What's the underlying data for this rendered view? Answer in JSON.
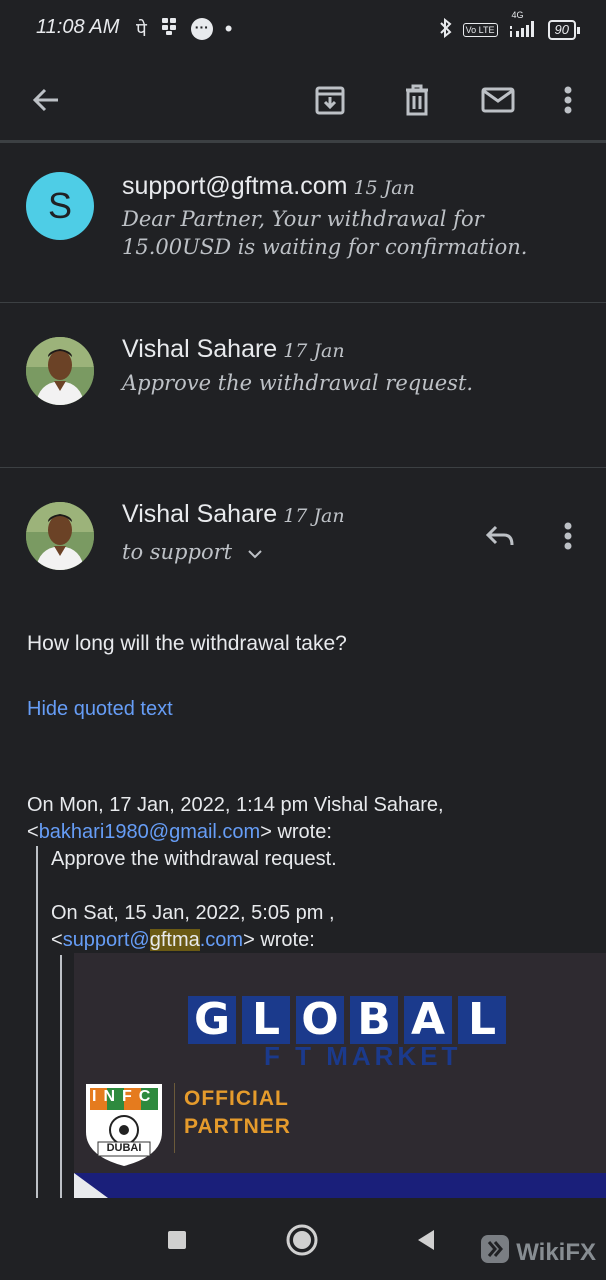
{
  "status_bar": {
    "time": "11:08 AM",
    "left_icons": [
      "pe-icon",
      "bbm-icon",
      "chat-icon"
    ],
    "network": "4G",
    "volte": "Vo LTE",
    "battery": "90"
  },
  "toolbar": {
    "icons": [
      "back-arrow-icon",
      "archive-icon",
      "delete-icon",
      "mark-unread-icon",
      "more-vert-icon"
    ]
  },
  "messages": [
    {
      "avatar_letter": "S",
      "sender": "support@gftma.com",
      "date": "15 Jan",
      "snippet": "Dear Partner, Your withdrawal for 15.00USD is waiting for confirmation."
    },
    {
      "sender": "Vishal Sahare",
      "date": "17 Jan",
      "snippet": "Approve the withdrawal request."
    }
  ],
  "open_message": {
    "sender": "Vishal Sahare",
    "date": "17 Jan",
    "to_line": "to support",
    "body": "How long will the withdrawal take?",
    "hide_quoted": "Hide quoted text",
    "quote_header_line1": "On Mon, 17 Jan, 2022, 1:14 pm Vishal Sahare,",
    "quote_email_open": "<",
    "quote_email": "bakhari1980@gmail.com",
    "quote_email_close": "> wrote:",
    "quote1_text": "Approve the withdrawal request.",
    "quote2_header": "On Sat, 15 Jan, 2022, 5:05 pm ,",
    "quote2_open": "<",
    "quote2_email_a": "support@",
    "quote2_email_highlight": "gftma",
    "quote2_email_b": ".com",
    "quote2_close": "> wrote:"
  },
  "banner": {
    "letters": [
      "G",
      "L",
      "O",
      "B",
      "A",
      "L"
    ],
    "subtitle": "F T MARKET",
    "badge_letters": "INFC",
    "badge_city": "DUBAI",
    "partner_line1": "OFFICIAL",
    "partner_line2": "PARTNER"
  },
  "watermark": "WikiFX",
  "colors": {
    "background": "#202124",
    "link": "#669df6",
    "avatar_s": "#4ecde6",
    "highlight": "#6b5a14"
  }
}
